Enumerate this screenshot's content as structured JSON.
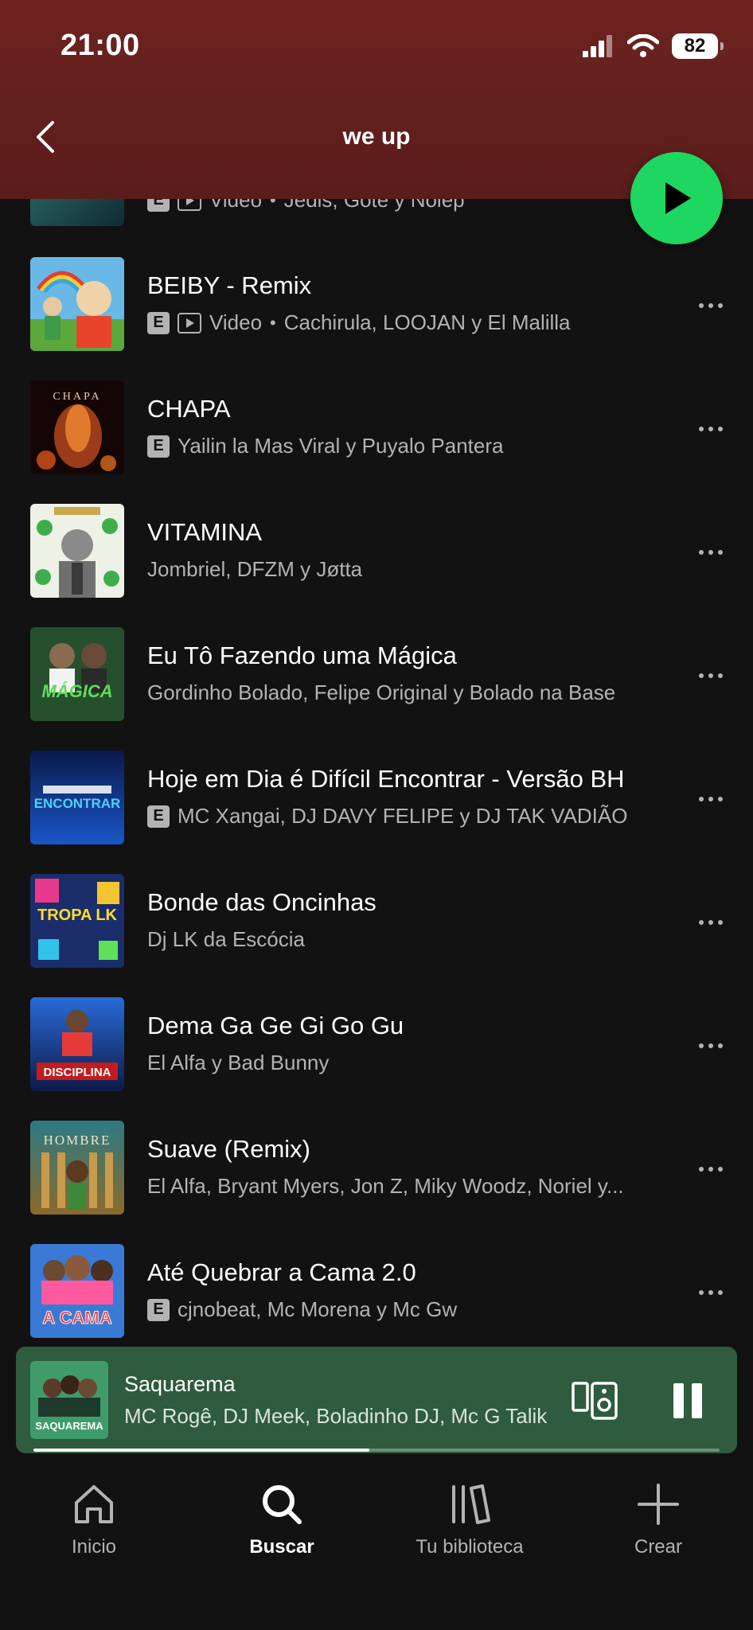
{
  "status_bar": {
    "time": "21:00",
    "battery": "82"
  },
  "header": {
    "title": "we up"
  },
  "colors": {
    "accent": "#1ed760",
    "header_bg": "#6e2320",
    "mini_player_bg": "#2f5b3e"
  },
  "tracks": [
    {
      "title": "",
      "explicit": true,
      "video": true,
      "video_label": "Video",
      "artists": "Jedis, Gote y Nolep"
    },
    {
      "title": "BEIBY - Remix",
      "explicit": true,
      "video": true,
      "video_label": "Video",
      "artists": "Cachirula, LOOJAN y El Malilla"
    },
    {
      "title": "CHAPA",
      "explicit": true,
      "video": false,
      "artists": "Yailin la Mas Viral y Puyalo Pantera",
      "cover_text": "CHAPA"
    },
    {
      "title": "VITAMINA",
      "explicit": false,
      "video": false,
      "artists": "Jombriel, DFZM y Jøtta"
    },
    {
      "title": "Eu Tô Fazendo uma Mágica",
      "explicit": false,
      "video": false,
      "artists": "Gordinho Bolado, Felipe Original y Bolado na Base",
      "cover_text": "MÁGICA"
    },
    {
      "title": "Hoje em Dia é Difícil Encontrar - Versão BH",
      "explicit": true,
      "video": false,
      "artists": "MC Xangai, DJ DAVY FELIPE y DJ TAK VADIÃO",
      "cover_text": "ENCONTRAR"
    },
    {
      "title": "Bonde das Oncinhas",
      "explicit": false,
      "video": false,
      "artists": "Dj LK da Escócia",
      "cover_text": "TROPA LK"
    },
    {
      "title": "Dema Ga Ge Gi Go Gu",
      "explicit": false,
      "video": false,
      "artists": "El Alfa y Bad Bunny",
      "cover_text": "DISCIPLINA"
    },
    {
      "title": "Suave (Remix)",
      "explicit": false,
      "video": false,
      "artists": "El Alfa, Bryant Myers, Jon Z, Miky Woodz, Noriel y...",
      "cover_text": "HOMBRE"
    },
    {
      "title": "Até Quebrar a Cama 2.0",
      "explicit": true,
      "video": false,
      "artists": "cjnobeat, Mc Morena y Mc Gw",
      "cover_text": "A CAMA"
    }
  ],
  "now_playing": {
    "title": "Saquarema",
    "artists": "MC Rogê, DJ Meek, Boladinho DJ, Mc G Talik",
    "cover_text": "SAQUAREMA",
    "progress": 0.49
  },
  "bottom_nav": [
    {
      "label": "Inicio",
      "icon": "home-icon",
      "active": false
    },
    {
      "label": "Buscar",
      "icon": "search-icon",
      "active": true
    },
    {
      "label": "Tu biblioteca",
      "icon": "library-icon",
      "active": false
    },
    {
      "label": "Crear",
      "icon": "plus-icon",
      "active": false
    }
  ]
}
